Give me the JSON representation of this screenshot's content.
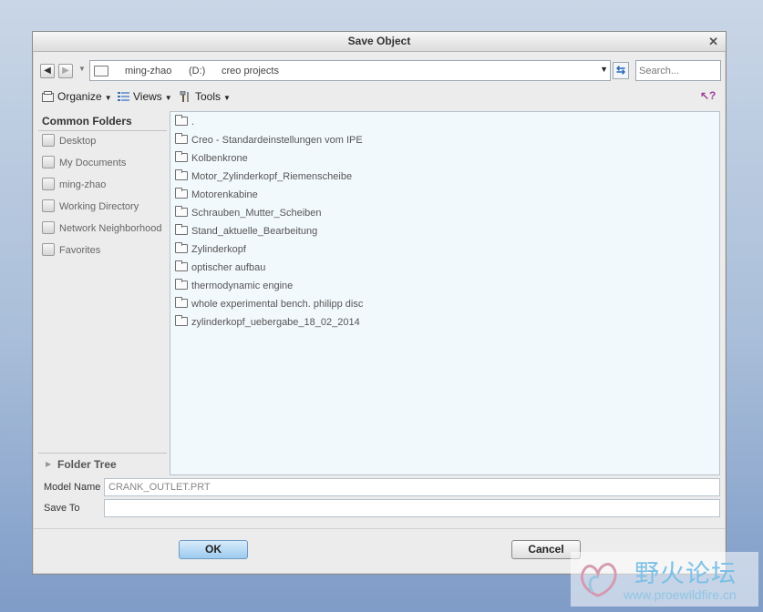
{
  "dialog": {
    "title": "Save Object",
    "close_glyph": "✕"
  },
  "address_bar": {
    "segments": [
      "ming-zhao",
      "(D:)",
      "creo projects"
    ],
    "back_icon": "back-arrow-icon",
    "forward_icon": "forward-arrow-icon",
    "refresh_icon": "refresh-icon"
  },
  "search": {
    "placeholder": "Search..."
  },
  "toolbar": {
    "organize_label": "Organize",
    "views_label": "Views",
    "tools_label": "Tools"
  },
  "common_folders": {
    "header": "Common Folders",
    "items": [
      {
        "label": "Desktop",
        "icon": "desktop-icon"
      },
      {
        "label": "My Documents",
        "icon": "documents-icon"
      },
      {
        "label": "ming-zhao",
        "icon": "computer-icon"
      },
      {
        "label": "Working Directory",
        "icon": "working-directory-icon"
      },
      {
        "label": "Network Neighborhood",
        "icon": "network-icon"
      },
      {
        "label": "Favorites",
        "icon": "favorites-icon"
      }
    ]
  },
  "folder_tree": {
    "label": "Folder Tree"
  },
  "files": [
    ".",
    "Creo - Standardeinstellungen vom IPE",
    "Kolbenkrone",
    "Motor_Zylinderkopf_Riemenscheibe",
    "Motorenkabine",
    "Schrauben_Mutter_Scheiben",
    "Stand_aktuelle_Bearbeitung",
    "Zylinderkopf",
    "optischer aufbau",
    "thermodynamic engine",
    "whole experimental bench. philipp disc",
    "zylinderkopf_uebergabe_18_02_2014"
  ],
  "model_name": {
    "label": "Model Name",
    "value": "CRANK_OUTLET.PRT"
  },
  "save_to": {
    "label": "Save To",
    "value": ""
  },
  "buttons": {
    "ok": "OK",
    "cancel": "Cancel"
  },
  "watermark": {
    "chinese": "野火论坛",
    "url": "www.proewildfire.cn"
  },
  "colors": {
    "accent": "#9ccbee",
    "list_bg": "#f2f9fc",
    "watermark": "#7cc0e6"
  }
}
